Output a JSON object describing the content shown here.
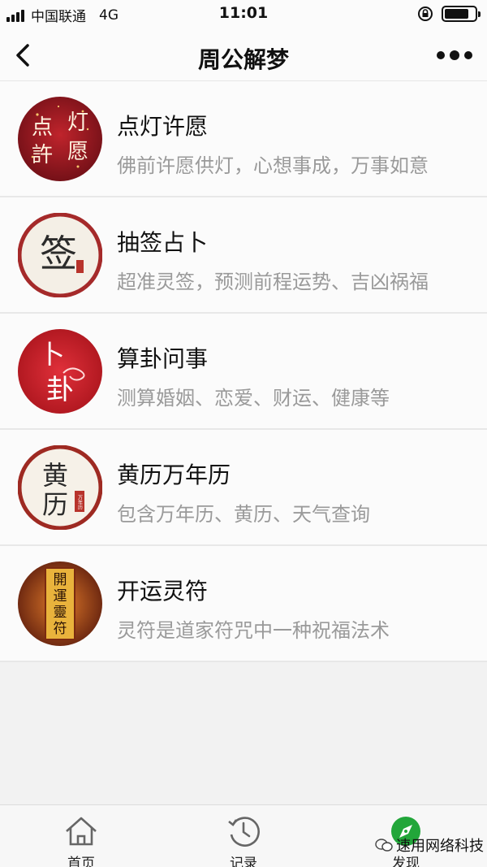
{
  "status_bar": {
    "carrier": "中国联通",
    "network": "4G",
    "time": "11:01",
    "battery_level": 0.8
  },
  "nav": {
    "title": "周公解梦",
    "back_icon": "chevron-left-icon",
    "more_icon": "more-dots-icon"
  },
  "items": [
    {
      "title": "点灯许愿",
      "desc": "佛前许愿供灯，心想事成，万事如意",
      "icon_text": [
        "点",
        "灯",
        "許",
        "愿"
      ],
      "icon_color": "#9c1a22"
    },
    {
      "title": "抽签占卜",
      "desc": "超准灵签，预测前程运势、吉凶祸福",
      "icon_text": [
        "签"
      ],
      "icon_color": "#a52a2a"
    },
    {
      "title": "算卦问事",
      "desc": "测算婚姻、恋爱、财运、健康等",
      "icon_text": [
        "卜",
        "卦"
      ],
      "icon_color": "#c41e24"
    },
    {
      "title": "黄历万年历",
      "desc": "包含万年历、黄历、天气查询",
      "icon_text": [
        "黄",
        "历",
        "万年历"
      ],
      "icon_color": "#9e2a22"
    },
    {
      "title": "开运灵符",
      "desc": "灵符是道家符咒中一种祝福法术",
      "icon_text": [
        "開",
        "運",
        "靈",
        "符"
      ],
      "icon_color": "#b5461a"
    }
  ],
  "tabs": [
    {
      "label": "首页",
      "icon": "home-icon"
    },
    {
      "label": "记录",
      "icon": "clock-icon"
    },
    {
      "label": "发现",
      "icon": "compass-icon",
      "active": true
    }
  ],
  "watermark": "速用网络科技",
  "colors": {
    "accent_green": "#22a63a",
    "text_secondary": "#9a9a9a"
  }
}
